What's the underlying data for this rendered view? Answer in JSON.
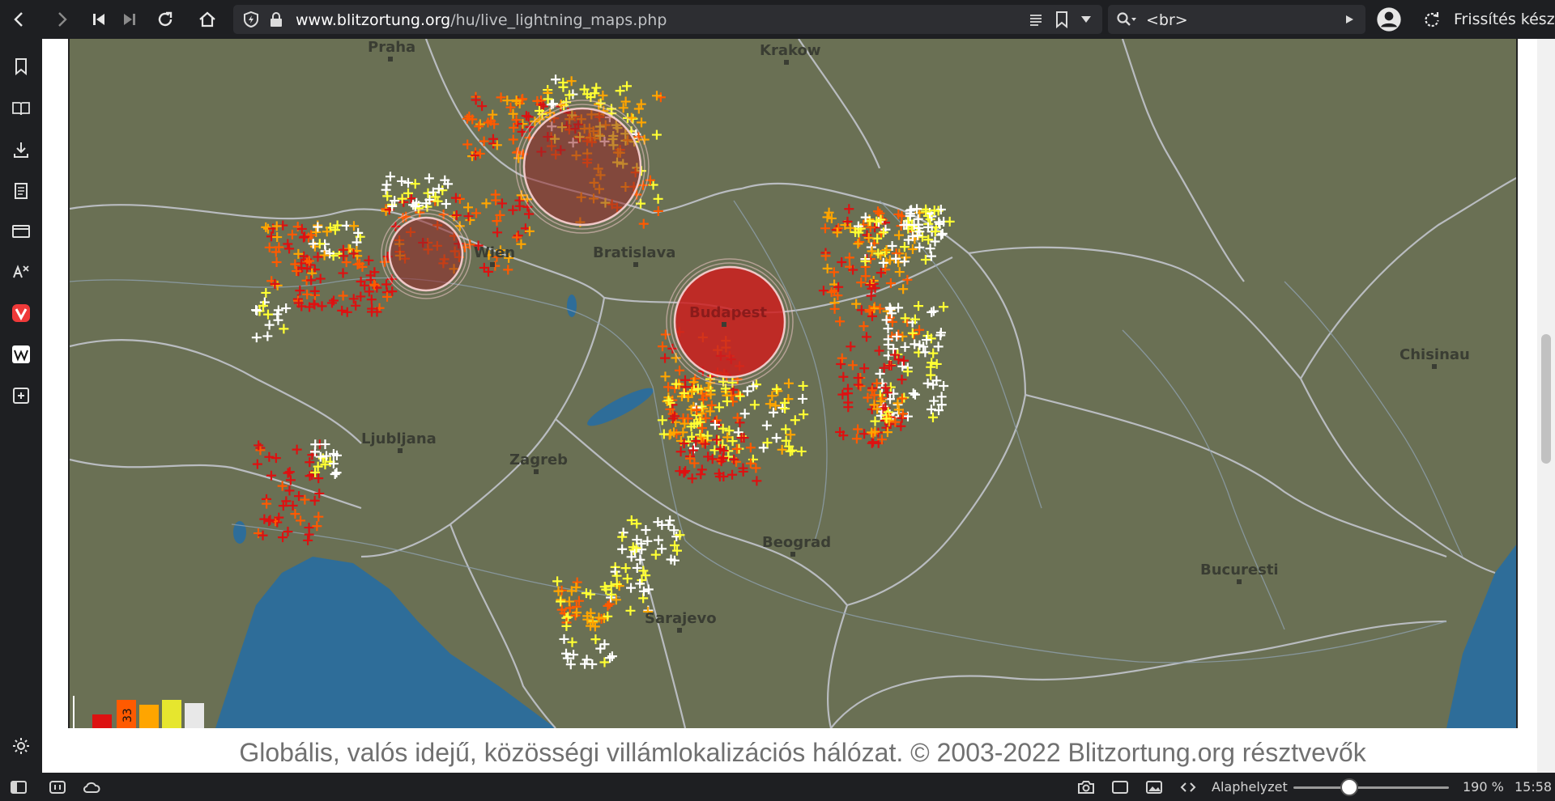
{
  "browser": {
    "url_domain": "www.blitzortung.org",
    "url_path": "/hu/live_lightning_maps.php",
    "search_value": "<br>",
    "refresh_label": "Frissítés kész"
  },
  "map": {
    "cities": [
      {
        "name": "Praha"
      },
      {
        "name": "Krakow"
      },
      {
        "name": "Bratislava"
      },
      {
        "name": "Wien"
      },
      {
        "name": "Budapest"
      },
      {
        "name": "Chisinau"
      },
      {
        "name": "Ljubljana"
      },
      {
        "name": "Zagreb"
      },
      {
        "name": "Beograd"
      },
      {
        "name": "Bucuresti"
      },
      {
        "name": "Sarajevo"
      }
    ],
    "legend_label": "33",
    "colors": {
      "land": "#6a7054",
      "sea": "#2e6d99",
      "borders": "#b9bcc0",
      "strike_newest": "#ffffff",
      "strike_new": "#ffff33",
      "strike_mid": "#ffa500",
      "strike_old": "#ff5a00",
      "strike_oldest": "#dd1111"
    }
  },
  "footer": {
    "text": "Globális, valós idejű, közösségi villámlokalizációs hálózat. © 2003-2022 Blitzortung.org résztvevők"
  },
  "statusbar": {
    "zoom_label": "Alaphelyzet",
    "zoom_value": "190 %",
    "clock": "15:58"
  }
}
